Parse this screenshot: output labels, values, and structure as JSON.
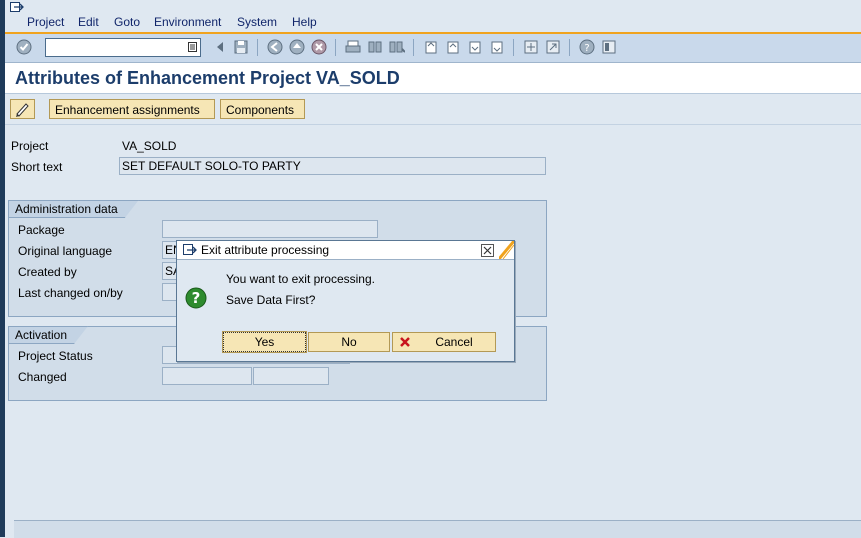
{
  "menu": {
    "items": [
      "Project",
      "Edit",
      "Goto",
      "Environment",
      "System",
      "Help"
    ]
  },
  "toolbar": {
    "command_field_value": ""
  },
  "title": "Attributes of Enhancement Project VA_SOLD",
  "app_toolbar": {
    "enhancement_assignments": "Enhancement assignments",
    "components": "Components"
  },
  "header_fields": {
    "project_label": "Project",
    "project_value": "VA_SOLD",
    "short_text_label": "Short text",
    "short_text_value": "SET DEFAULT SOLO-TO PARTY"
  },
  "admin": {
    "title": "Administration data",
    "package_label": "Package",
    "package_value": "",
    "orig_lang_label": "Original language",
    "orig_lang_value": "EN",
    "created_by_label": "Created by",
    "created_by_value": "SA",
    "last_changed_label": "Last changed on/by",
    "last_changed_value": ""
  },
  "activation": {
    "title": "Activation",
    "status_label": "Project Status",
    "status_value": "",
    "changed_label": "Changed",
    "changed_value1": "",
    "changed_value2": ""
  },
  "dialog": {
    "title": "Exit attribute processing",
    "line1": "You want to exit processing.",
    "line2": "Save Data First?",
    "yes": "Yes",
    "no": "No",
    "cancel": "Cancel"
  },
  "colors": {
    "accent": "#f0a31e",
    "title_blue": "#1c3d6b",
    "button_yellow": "#f6e6b5"
  }
}
